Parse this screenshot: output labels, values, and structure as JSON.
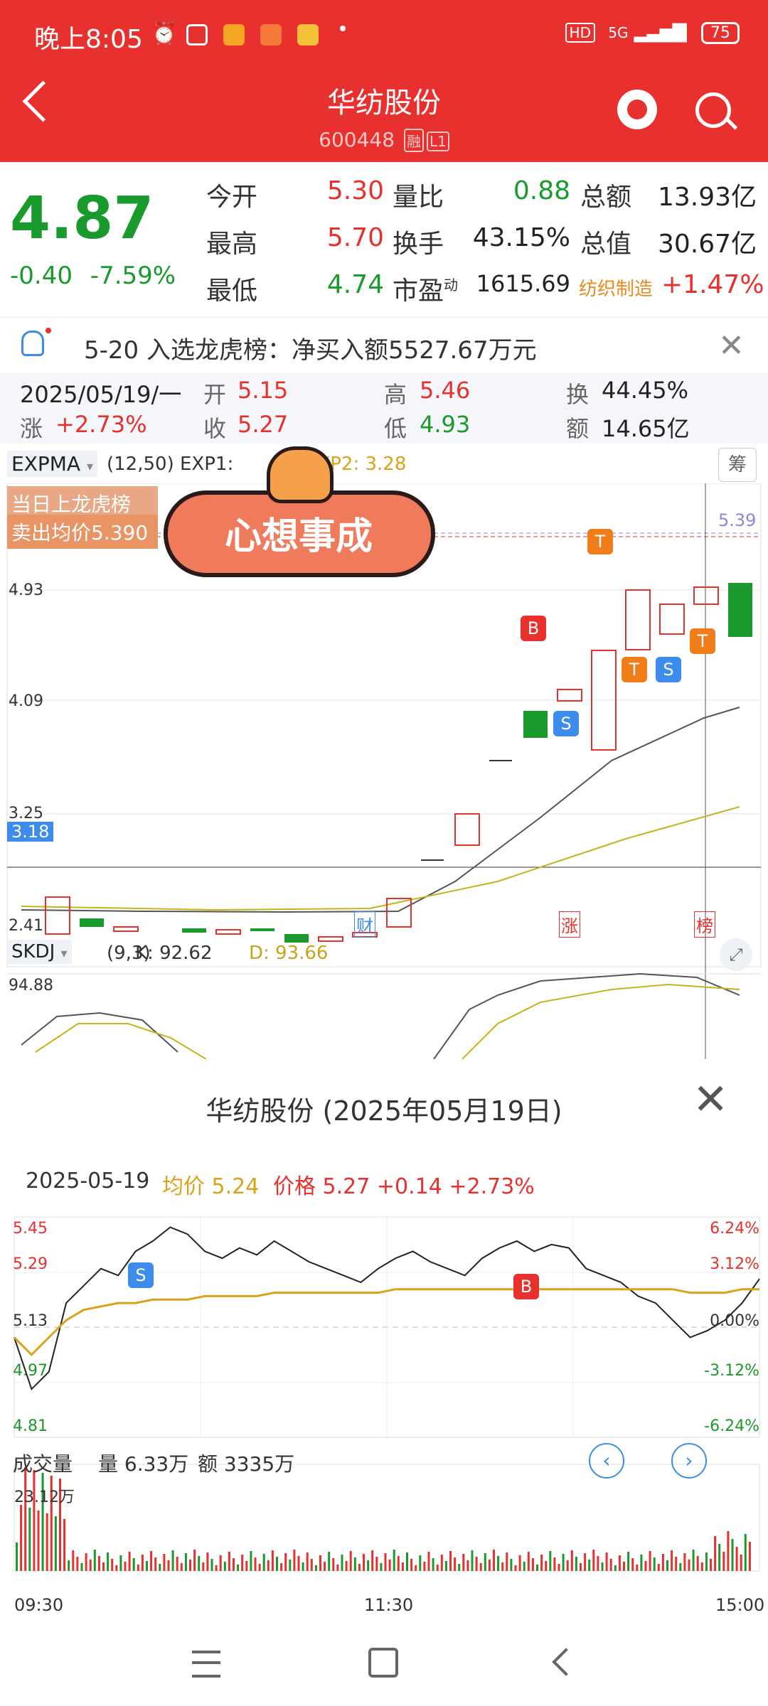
{
  "status": {
    "time": "晚上8:05",
    "network": "5G",
    "hd": "HD",
    "battery": "75"
  },
  "header": {
    "title": "华纺股份",
    "code": "600448",
    "tag1": "融",
    "tag2": "L1"
  },
  "quote": {
    "price": "4.87",
    "change": "-0.40",
    "change_pct": "-7.59%",
    "rows": [
      {
        "l1": "今开",
        "v1": "5.30",
        "l2": "量比",
        "v2": "0.88",
        "l3": "总额",
        "v3": "13.93亿"
      },
      {
        "l1": "最高",
        "v1": "5.70",
        "l2": "换手",
        "v2": "43.15%",
        "l3": "总值",
        "v3": "30.67亿"
      },
      {
        "l1": "最低",
        "v1": "4.74",
        "l2": "市盈",
        "l2sup": "动",
        "v2": "1615.69",
        "l3": "纺织制造",
        "v3": "+1.47%"
      }
    ]
  },
  "notice": {
    "text": "5-20 入选龙虎榜：净买入额5527.67万元"
  },
  "kline_info": {
    "date": "2025/05/19/一",
    "open_l": "开",
    "open": "5.15",
    "high_l": "高",
    "high": "5.46",
    "turn_l": "换",
    "turn": "44.45%",
    "chg_l": "涨",
    "chg": "+2.73%",
    "close_l": "收",
    "close": "5.27",
    "low_l": "低",
    "low": "4.93",
    "amt_l": "额",
    "amt": "14.65亿"
  },
  "main_chart": {
    "indicator": "EXPMA",
    "params": "(12,50)",
    "exp1": "EXP1: ",
    "exp2": "EXP2: 3.28",
    "chip_btn": "筹",
    "overlay_line1": "当日上龙虎榜",
    "overlay_line2": "卖出均价5.390",
    "sticker_text": "心想事成",
    "y_labels": [
      "4.93",
      "4.09",
      "3.25",
      "2.41"
    ],
    "cursor_price": "3.18",
    "right_price": "5.39",
    "markers": [
      {
        "text": "财"
      },
      {
        "text": "涨"
      },
      {
        "text": "榜"
      }
    ],
    "bs": [
      "B",
      "S",
      "T",
      "T",
      "S",
      "T"
    ]
  },
  "sub_chart": {
    "indicator": "SKDJ",
    "params": "(9,3)",
    "k": "K: 92.62",
    "d": "D: 93.66",
    "y_top": "94.88"
  },
  "intraday": {
    "title": "华纺股份 (2025年05月19日)",
    "date": "2025-05-19",
    "avg_l": "均价",
    "avg": "5.24",
    "price_l": "价格",
    "price": "5.27",
    "chg": "+0.14",
    "pct": "+2.73%",
    "left_axis": [
      "5.45",
      "5.29",
      "5.13",
      "4.97",
      "4.81"
    ],
    "right_axis": [
      "6.24%",
      "3.12%",
      "0.00%",
      "-3.12%",
      "-6.24%"
    ],
    "marks": [
      "S",
      "B"
    ],
    "vol_label": "成交量",
    "vol": "量 6.33万",
    "amt": "额 3335万",
    "vol_max": "23.12万",
    "times": [
      "09:30",
      "11:30",
      "15:00"
    ]
  },
  "chart_data": {
    "type": "line",
    "title": "",
    "xlabel": "",
    "ylabel": "",
    "ylim": [
      4.81,
      5.45
    ],
    "series": [
      {
        "name": "价格",
        "values": [
          5.1,
          4.95,
          5.0,
          5.2,
          5.25,
          5.3,
          5.28,
          5.35,
          5.38,
          5.42,
          5.4,
          5.35,
          5.33,
          5.36,
          5.34,
          5.38,
          5.35,
          5.32,
          5.3,
          5.28,
          5.26,
          5.3,
          5.33,
          5.35,
          5.32,
          5.3,
          5.28,
          5.33,
          5.36,
          5.38,
          5.35,
          5.37,
          5.36,
          5.3,
          5.28,
          5.26,
          5.22,
          5.2,
          5.15,
          5.1,
          5.12,
          5.15,
          5.2,
          5.27
        ]
      },
      {
        "name": "均价",
        "values": [
          5.1,
          5.05,
          5.1,
          5.15,
          5.18,
          5.19,
          5.2,
          5.2,
          5.21,
          5.21,
          5.21,
          5.22,
          5.22,
          5.22,
          5.22,
          5.23,
          5.23,
          5.23,
          5.23,
          5.23,
          5.23,
          5.23,
          5.24,
          5.24,
          5.24,
          5.24,
          5.24,
          5.24,
          5.24,
          5.24,
          5.24,
          5.24,
          5.24,
          5.24,
          5.24,
          5.24,
          5.24,
          5.24,
          5.24,
          5.23,
          5.23,
          5.23,
          5.24,
          5.24
        ]
      }
    ]
  },
  "colors": {
    "red": "#e8302e",
    "green": "#1a9a2c",
    "orange": "#e88a1a",
    "blue": "#3d8bea",
    "avg": "#d9a21b"
  }
}
